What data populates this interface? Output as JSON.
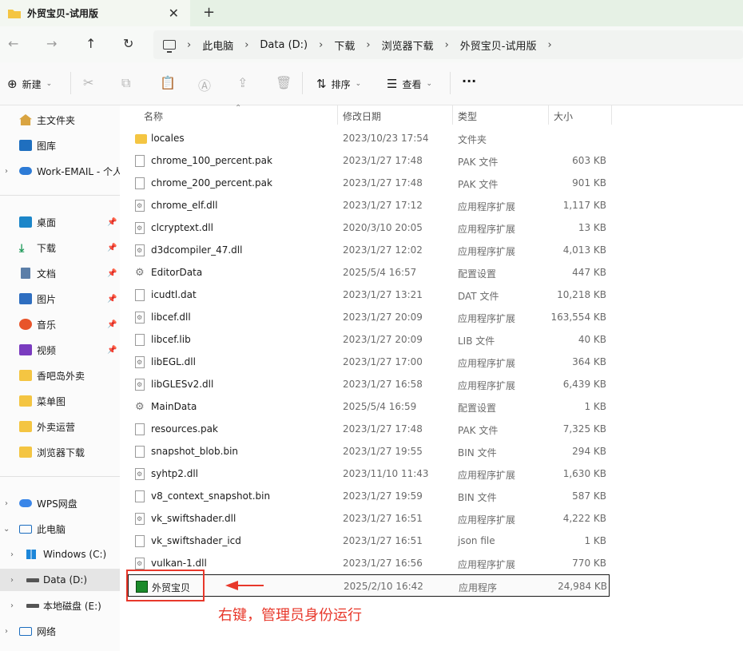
{
  "tab": {
    "title": "外贸宝贝-试用版",
    "close": "✕",
    "new": "+"
  },
  "nav": {
    "back": "←",
    "forward": "→",
    "up": "↑",
    "refresh": "↻"
  },
  "breadcrumbs": [
    "此电脑",
    "Data (D:)",
    "下载",
    "浏览器下载",
    "外贸宝贝-试用版"
  ],
  "breadcrumb_sep": "›",
  "toolbar": {
    "new_label": "新建",
    "sort_label": "排序",
    "view_label": "查看",
    "more": "···"
  },
  "sidebar": {
    "items": [
      {
        "label": "主文件夹",
        "icon": "home-icon"
      },
      {
        "label": "图库",
        "icon": "gallery-icon"
      },
      {
        "label": "Work-EMAIL - 个人",
        "icon": "cloud-icon"
      },
      {
        "label": "桌面",
        "icon": "desktop-icon",
        "pinned": true
      },
      {
        "label": "下载",
        "icon": "download-icon",
        "pinned": true
      },
      {
        "label": "文档",
        "icon": "documents-icon",
        "pinned": true
      },
      {
        "label": "图片",
        "icon": "pictures-icon",
        "pinned": true
      },
      {
        "label": "音乐",
        "icon": "music-icon",
        "pinned": true
      },
      {
        "label": "视频",
        "icon": "video-icon",
        "pinned": true
      },
      {
        "label": "香吧岛外卖",
        "icon": "folder-icon"
      },
      {
        "label": "菜单图",
        "icon": "folder-icon"
      },
      {
        "label": "外卖运营",
        "icon": "folder-icon"
      },
      {
        "label": "浏览器下载",
        "icon": "folder-icon"
      },
      {
        "label": "WPS网盘",
        "icon": "wps-cloud-icon"
      },
      {
        "label": "此电脑",
        "icon": "this-pc-icon"
      },
      {
        "label": "Windows (C:)",
        "icon": "windows-drive-icon"
      },
      {
        "label": "Data (D:)",
        "icon": "drive-icon"
      },
      {
        "label": "本地磁盘 (E:)",
        "icon": "drive-icon"
      },
      {
        "label": "网络",
        "icon": "network-icon"
      }
    ]
  },
  "columns": {
    "name": "名称",
    "date": "修改日期",
    "type": "类型",
    "size": "大小"
  },
  "files": [
    {
      "name": "locales",
      "date": "2023/10/23 17:54",
      "type": "文件夹",
      "size": ""
    },
    {
      "name": "chrome_100_percent.pak",
      "date": "2023/1/27 17:48",
      "type": "PAK 文件",
      "size": "603 KB"
    },
    {
      "name": "chrome_200_percent.pak",
      "date": "2023/1/27 17:48",
      "type": "PAK 文件",
      "size": "901 KB"
    },
    {
      "name": "chrome_elf.dll",
      "date": "2023/1/27 17:12",
      "type": "应用程序扩展",
      "size": "1,117 KB"
    },
    {
      "name": "clcryptext.dll",
      "date": "2020/3/10 20:05",
      "type": "应用程序扩展",
      "size": "13 KB"
    },
    {
      "name": "d3dcompiler_47.dll",
      "date": "2023/1/27 12:02",
      "type": "应用程序扩展",
      "size": "4,013 KB"
    },
    {
      "name": "EditorData",
      "date": "2025/5/4 16:57",
      "type": "配置设置",
      "size": "447 KB"
    },
    {
      "name": "icudtl.dat",
      "date": "2023/1/27 13:21",
      "type": "DAT 文件",
      "size": "10,218 KB"
    },
    {
      "name": "libcef.dll",
      "date": "2023/1/27 20:09",
      "type": "应用程序扩展",
      "size": "163,554 KB"
    },
    {
      "name": "libcef.lib",
      "date": "2023/1/27 20:09",
      "type": "LIB 文件",
      "size": "40 KB"
    },
    {
      "name": "libEGL.dll",
      "date": "2023/1/27 17:00",
      "type": "应用程序扩展",
      "size": "364 KB"
    },
    {
      "name": "libGLESv2.dll",
      "date": "2023/1/27 16:58",
      "type": "应用程序扩展",
      "size": "6,439 KB"
    },
    {
      "name": "MainData",
      "date": "2025/5/4 16:59",
      "type": "配置设置",
      "size": "1 KB"
    },
    {
      "name": "resources.pak",
      "date": "2023/1/27 17:48",
      "type": "PAK 文件",
      "size": "7,325 KB"
    },
    {
      "name": "snapshot_blob.bin",
      "date": "2023/1/27 19:55",
      "type": "BIN 文件",
      "size": "294 KB"
    },
    {
      "name": "syhtp2.dll",
      "date": "2023/11/10 11:43",
      "type": "应用程序扩展",
      "size": "1,630 KB"
    },
    {
      "name": "v8_context_snapshot.bin",
      "date": "2023/1/27 19:59",
      "type": "BIN 文件",
      "size": "587 KB"
    },
    {
      "name": "vk_swiftshader.dll",
      "date": "2023/1/27 16:51",
      "type": "应用程序扩展",
      "size": "4,222 KB"
    },
    {
      "name": "vk_swiftshader_icd",
      "date": "2023/1/27 16:51",
      "type": "json file",
      "size": "1 KB"
    },
    {
      "name": "vulkan-1.dll",
      "date": "2023/1/27 16:56",
      "type": "应用程序扩展",
      "size": "770 KB"
    },
    {
      "name": "外贸宝贝",
      "date": "2025/2/10 16:42",
      "type": "应用程序",
      "size": "24,984 KB"
    }
  ],
  "annotation": {
    "text": "右键，管理员身份运行",
    "color": "#e8382b"
  }
}
